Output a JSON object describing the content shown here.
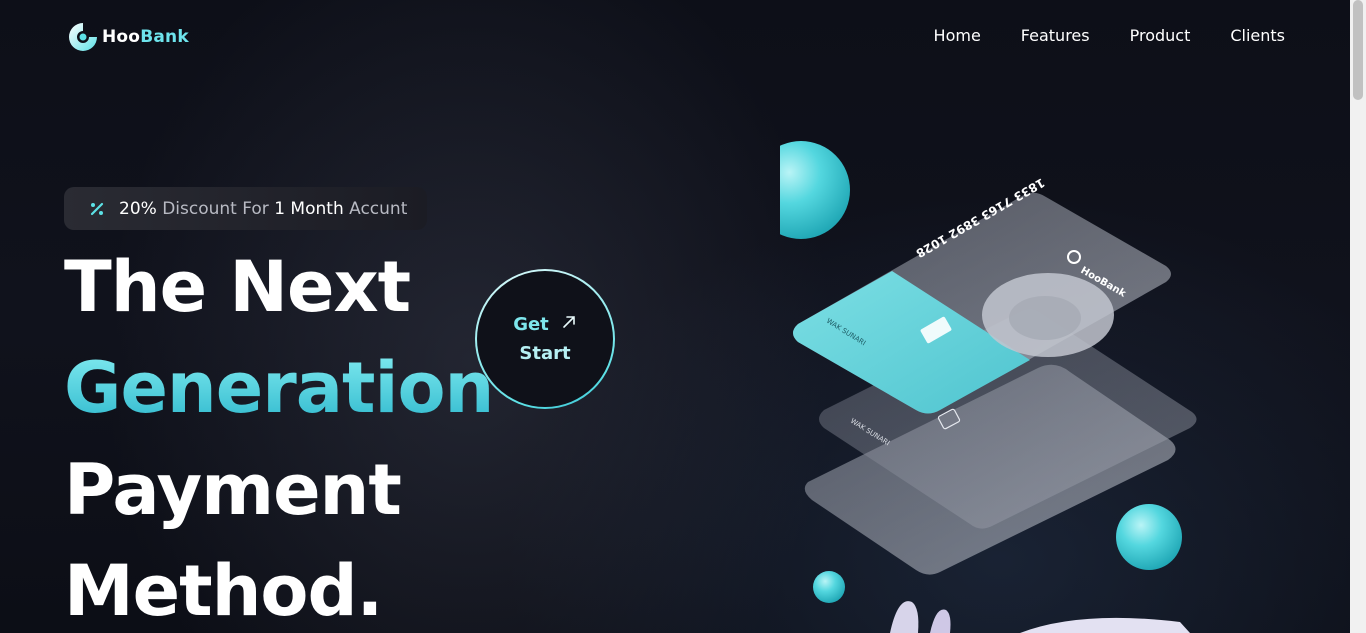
{
  "brand": {
    "name_part1": "Hoo",
    "name_part2": "Bank",
    "logo_icon": "hoobank-logo-icon"
  },
  "nav": {
    "items": [
      "Home",
      "Features",
      "Product",
      "Clients"
    ]
  },
  "discount": {
    "icon": "discount-icon",
    "part1": "20%",
    "part2": " Discount For ",
    "part3": "1",
    "part4": " Month",
    "part5": " Accunt"
  },
  "hero": {
    "line1": "The Next",
    "line2": "Generation",
    "line3": "Payment",
    "line4": "Method."
  },
  "cta": {
    "line1": "Get",
    "line2": "Start",
    "icon": "arrow-up-right-icon"
  },
  "card": {
    "number": "1833 7163 3892 1028",
    "holder": "WAK SUNARI",
    "brand": "HooBank"
  },
  "colors": {
    "accent": "#5ce1e6",
    "background": "#00040f",
    "pill": "#24252d"
  }
}
